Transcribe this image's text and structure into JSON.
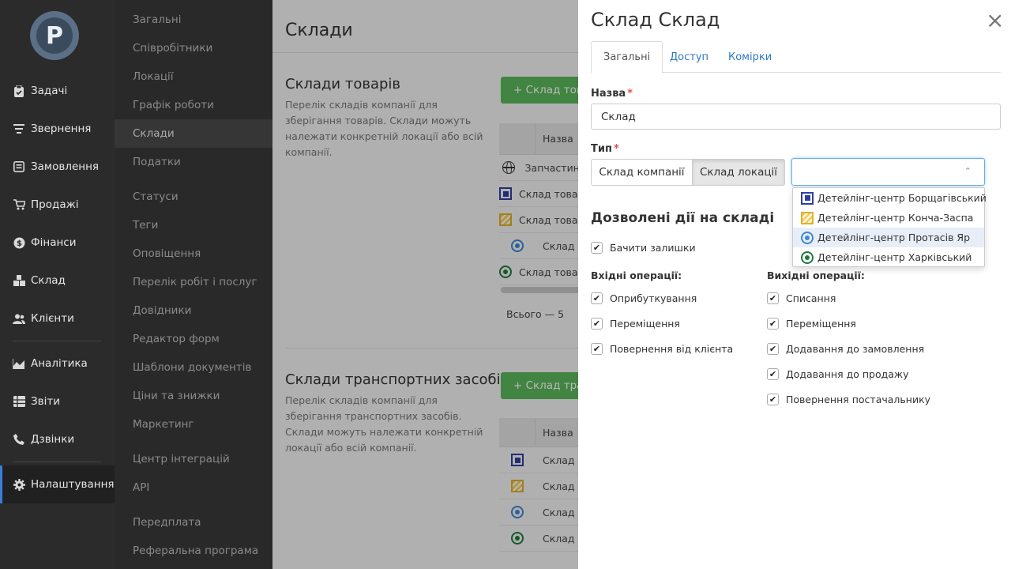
{
  "nav": {
    "logo_letter": "P",
    "items": [
      {
        "label": "Задачі",
        "icon": "clipboard-icon"
      },
      {
        "label": "Звернення",
        "icon": "filter-lines-icon"
      },
      {
        "label": "Замовлення",
        "icon": "receipt-icon"
      },
      {
        "label": "Продажі",
        "icon": "cart-icon"
      },
      {
        "label": "Фінанси",
        "icon": "dollar-icon"
      },
      {
        "label": "Склад",
        "icon": "boxes-icon"
      },
      {
        "label": "Клієнти",
        "icon": "users-icon"
      },
      {
        "label": "Аналітика",
        "icon": "area-chart-icon"
      },
      {
        "label": "Звіти",
        "icon": "table-icon"
      },
      {
        "label": "Дзвінки",
        "icon": "phone-icon"
      },
      {
        "label": "Налаштування",
        "icon": "gear-icon"
      }
    ]
  },
  "subnav": {
    "items": [
      "Загальні",
      "Співробітники",
      "Локації",
      "Графік роботи",
      "Склади",
      "Податки",
      "Статуси",
      "Теги",
      "Оповіщення",
      "Перелік робіт і послуг",
      "Довідники",
      "Редактор форм",
      "Шаблони документів",
      "Ціни та знижки",
      "Маркетинг",
      "Центр інтеграцій",
      "API",
      "Передплата",
      "Реферальна програма"
    ]
  },
  "main": {
    "title": "Склади",
    "goods": {
      "title": "Склади товарів",
      "desc": "Перелік складів компанії для зберігання товарів. Склади можуть належати конкретній локації або всій компанії.",
      "add_btn": "+ Склад товарів",
      "col_name": "Назва",
      "rows": [
        "Запчастини",
        "Склад товарів",
        "Склад товарів",
        "Склад",
        "Склад товарів"
      ],
      "total": "Всього — 5"
    },
    "vehicles": {
      "title": "Склади транспортних засобів",
      "desc": "Перелік складів компанії для зберігання транспортних засобів. Склади можуть належати конкретній локації або всій компанії.",
      "add_btn": "+ Склад транспорту",
      "col_name": "Назва",
      "rows": [
        "Склад в",
        "Склад в",
        "Склад",
        "Склад в"
      ]
    }
  },
  "modal": {
    "title": "Склад Склад",
    "close": "×",
    "tabs": [
      "Загальні",
      "Доступ",
      "Комірки"
    ],
    "name_label": "Назва",
    "name_value": "Склад",
    "required_mark": "*",
    "type_label": "Тип",
    "type_options": [
      "Склад компанії",
      "Склад локації"
    ],
    "selected_type": "Склад локації",
    "select_chevron": "⌃",
    "location_options": [
      "Детейлінг-центр Борщагівський",
      "Детейлінг-центр Конча-Заспа",
      "Детейлінг-центр Протасів Яр",
      "Детейлінг-центр Харківський"
    ],
    "permissions_title": "Дозволені дії на складі",
    "see_balances": "Бачити залишки",
    "incoming_title": "Вхідні операції:",
    "incoming": [
      "Оприбуткування",
      "Переміщення",
      "Повернення від клієнта"
    ],
    "outgoing_title": "Вихідні операції:",
    "outgoing": [
      "Списання",
      "Переміщення",
      "Додавання до замовлення",
      "Додавання до продажу",
      "Повернення постачальнику"
    ],
    "check_mark": "✔"
  }
}
